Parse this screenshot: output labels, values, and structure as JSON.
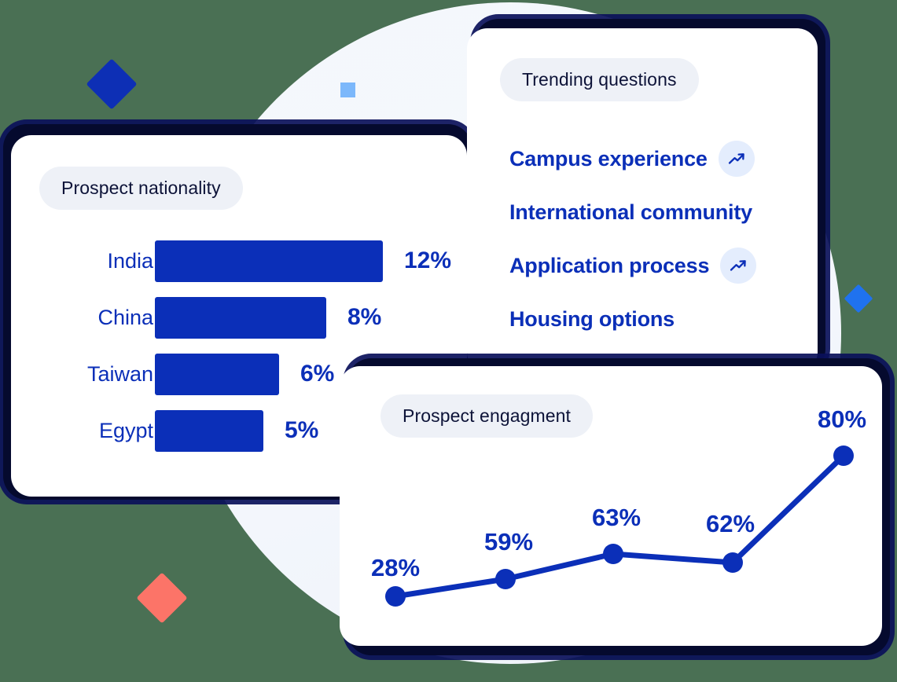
{
  "background": {
    "canvas_color": "#4a7054",
    "circle_color": "#f4f7fc",
    "decorations": [
      {
        "name": "diamond-blue-large",
        "color": "#0d2fb5"
      },
      {
        "name": "square-light-blue",
        "color": "#7cb8fb"
      },
      {
        "name": "diamond-salmon",
        "color": "#fc7468"
      },
      {
        "name": "diamond-blue-small",
        "color": "#1f72ef"
      }
    ]
  },
  "theme": {
    "accent_blue": "#0b2fb8",
    "pill_bg": "#eef1f7",
    "pill_text": "#0d1338",
    "badge_bg": "#e4edfd",
    "card_bg": "#ffffff",
    "card_shadow": "#050a2e"
  },
  "bar_card": {
    "title": "Prospect nationality"
  },
  "trending_card": {
    "title": "Trending questions",
    "items": [
      {
        "label": "Campus experience",
        "trending": true,
        "icon": "trending-up-icon"
      },
      {
        "label": "International community",
        "trending": false,
        "icon": ""
      },
      {
        "label": "Application process",
        "trending": true,
        "icon": "trending-up-icon"
      },
      {
        "label": "Housing options",
        "trending": false,
        "icon": ""
      }
    ]
  },
  "line_card": {
    "title": "Prospect engagment"
  },
  "chart_data": [
    {
      "type": "bar",
      "title": "Prospect nationality",
      "orientation": "horizontal",
      "categories": [
        "India",
        "China",
        "Taiwan",
        "Egypt"
      ],
      "values": [
        12,
        8,
        6,
        5
      ],
      "value_labels": [
        "12%",
        "8%",
        "6%",
        "5%"
      ],
      "unit": "%",
      "bar_color": "#0b2fb8",
      "label_color": "#0b2fb8",
      "xlabel": "",
      "ylabel": "",
      "xlim": [
        0,
        12
      ],
      "grid": false,
      "legend": "none"
    },
    {
      "type": "line",
      "title": "Prospect engagment",
      "x": [
        1,
        2,
        3,
        4,
        5
      ],
      "values": [
        28,
        59,
        63,
        62,
        80
      ],
      "value_labels": [
        "28%",
        "59%",
        "63%",
        "62%",
        "80%"
      ],
      "unit": "%",
      "line_color": "#0b2fb8",
      "marker": "circle",
      "marker_color": "#0b2fb8",
      "xlabel": "",
      "ylabel": "",
      "ylim": [
        0,
        100
      ],
      "grid": false,
      "legend": "none"
    }
  ]
}
